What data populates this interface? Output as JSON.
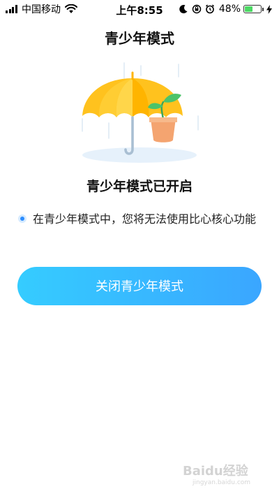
{
  "status_bar": {
    "carrier": "中国移动",
    "time": "上午8:55",
    "battery_percent": "48%",
    "battery_level": 0.48,
    "battery_color": "#4cd964",
    "icons": [
      "signal-icon",
      "wifi-icon",
      "moon-icon",
      "rotation-lock-icon",
      "alarm-icon",
      "battery-icon",
      "charging-icon"
    ]
  },
  "header": {
    "title": "青少年模式"
  },
  "illustration": {
    "icons": [
      "umbrella-icon",
      "plant-pot-icon"
    ],
    "umbrella_color": "#ffc21e",
    "pot_color": "#f4a470",
    "leaf_color": "#4cc36a"
  },
  "main": {
    "status_heading": "青少年模式已开启",
    "info_text": "在青少年模式中，您将无法使用比心核心功能",
    "bullet_color": "#2b8cff"
  },
  "actions": {
    "close_label": "关闭青少年模式",
    "accent_start": "#35ccff",
    "accent_end": "#3aa6ff"
  },
  "watermark": {
    "text": "Baidu经验",
    "sub": "jingyan.baidu.com"
  }
}
